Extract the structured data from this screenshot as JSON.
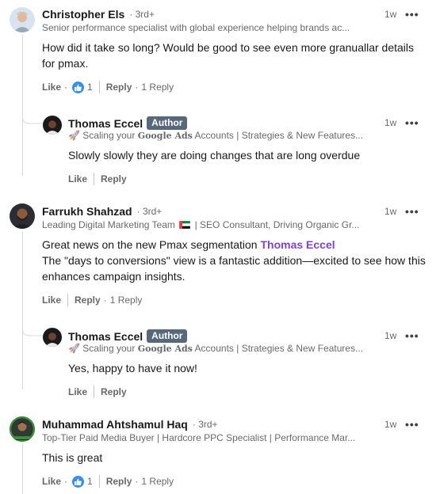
{
  "comments": [
    {
      "name": "Christopher Els",
      "degree": "3rd+",
      "headline": "Senior performance specialist with global experience helping brands ac...",
      "time": "1w",
      "text": "How did it take so long? Would be good to see even more granuallar details for pmax.",
      "like_label": "Like",
      "reaction_count": "1",
      "reply_label": "Reply",
      "replies_count_label": "1 Reply",
      "reply": {
        "name": "Thomas Eccel",
        "badge": "Author",
        "headline_emoji": "🚀",
        "headline_pre": "Scaling your",
        "headline_bold": "Google Ads",
        "headline_post": "Accounts | Strategies & New Features...",
        "time": "1w",
        "text": "Slowly slowly they are doing changes that are long overdue",
        "like_label": "Like",
        "reply_label": "Reply"
      }
    },
    {
      "name": "Farrukh Shahzad",
      "degree": "3rd+",
      "headline_pre": "Leading Digital Marketing Team",
      "headline_post": "| SEO Consultant, Driving Organic Gr...",
      "time": "1w",
      "text_pre": "Great news on the new Pmax segmentation",
      "mention": "Thomas Eccel",
      "text_post": " The \"days to conversions\" view is a fantastic addition—excited to see how this enhances campaign insights.",
      "like_label": "Like",
      "reply_label": "Reply",
      "replies_count_label": "1 Reply",
      "reply": {
        "name": "Thomas Eccel",
        "badge": "Author",
        "headline_emoji": "🚀",
        "headline_pre": "Scaling your",
        "headline_bold": "Google Ads",
        "headline_post": "Accounts | Strategies & New Features...",
        "time": "1w",
        "text": "Yes, happy to have it now!",
        "like_label": "Like",
        "reply_label": "Reply"
      }
    },
    {
      "name": "Muhammad Ahtshamul Haq",
      "degree": "3rd+",
      "headline": "Top-Tier Paid Media Buyer | Hardcore PPC Specialist | Performance Mar...",
      "time": "1w",
      "text": "This is great",
      "like_label": "Like",
      "reaction_count": "1",
      "reply_label": "Reply",
      "replies_count_label": "1 Reply"
    }
  ],
  "icons": {
    "more": "more-horizontal-icon",
    "reaction": "thumbs-up-reaction-icon",
    "flag": "uae-flag-icon",
    "rocket": "rocket-icon"
  },
  "colors": {
    "mention": "#8344cc",
    "badge_bg": "#56687a",
    "like_blue": "#378fe9",
    "thread_line": "#d9d9d9"
  }
}
